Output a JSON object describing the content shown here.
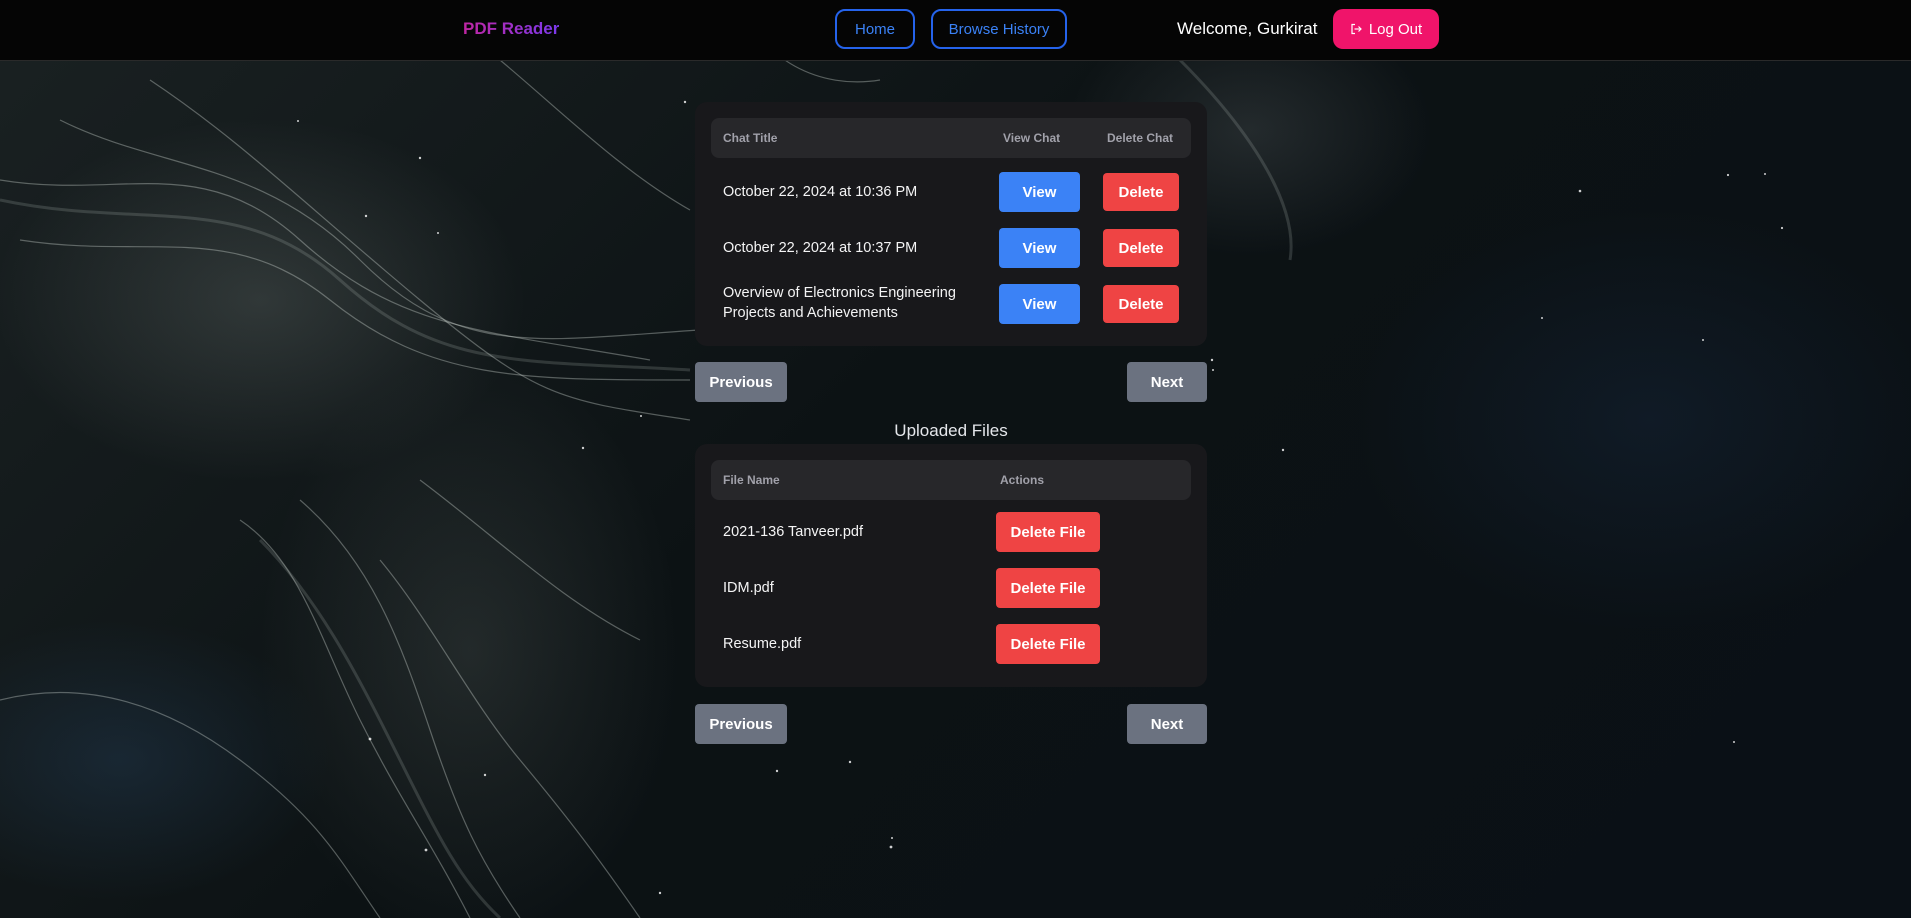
{
  "header": {
    "brand": "PDF Reader",
    "nav": {
      "home": "Home",
      "history": "Browse History"
    },
    "welcome": "Welcome, Gurkirat",
    "logout": "Log Out",
    "logout_icon": "logout-icon"
  },
  "chats": {
    "columns": {
      "title": "Chat Title",
      "view": "View Chat",
      "delete": "Delete Chat"
    },
    "rows": [
      {
        "title": "October 22, 2024 at 10:36 PM",
        "view": "View",
        "delete": "Delete"
      },
      {
        "title": "October 22, 2024 at 10:37 PM",
        "view": "View",
        "delete": "Delete"
      },
      {
        "title": "Overview of Electronics Engineering Projects and Achievements",
        "view": "View",
        "delete": "Delete"
      }
    ],
    "pagination": {
      "prev": "Previous",
      "next": "Next"
    }
  },
  "files": {
    "section_title": "Uploaded Files",
    "columns": {
      "name": "File Name",
      "actions": "Actions"
    },
    "rows": [
      {
        "name": "2021-136 Tanveer.pdf",
        "action": "Delete File"
      },
      {
        "name": "IDM.pdf",
        "action": "Delete File"
      },
      {
        "name": "Resume.pdf",
        "action": "Delete File"
      }
    ],
    "pagination": {
      "prev": "Previous",
      "next": "Next"
    }
  },
  "colors": {
    "primary": "#3b82f6",
    "danger": "#ef4444",
    "logout": "#f0146a",
    "pager": "#6b7280",
    "panel": "#18181b"
  }
}
